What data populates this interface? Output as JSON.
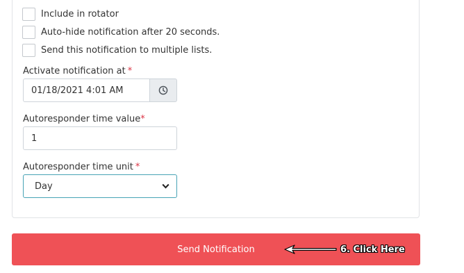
{
  "checkboxes": [
    {
      "label": "Include in rotator",
      "checked": false
    },
    {
      "label": "Auto-hide notification after 20 seconds.",
      "checked": false
    },
    {
      "label": "Send this notification to multiple lists.",
      "checked": false
    }
  ],
  "activate": {
    "label": "Activate notification at",
    "required_mark": "*",
    "value": "01/18/2021 4:01 AM",
    "icon": "clock-icon"
  },
  "time_value": {
    "label": "Autoresponder time value",
    "required_mark": "*",
    "value": "1"
  },
  "time_unit": {
    "label": "Autoresponder time unit",
    "required_mark": "*",
    "selected": "Day",
    "icon": "chevron-down-icon"
  },
  "send_button": {
    "label": "Send Notification"
  },
  "annotation": {
    "text": "6. Click Here",
    "icon": "arrow-left-icon"
  },
  "colors": {
    "button": "#ef5156",
    "required": "#dc3545",
    "select_border": "#47a3b5"
  }
}
